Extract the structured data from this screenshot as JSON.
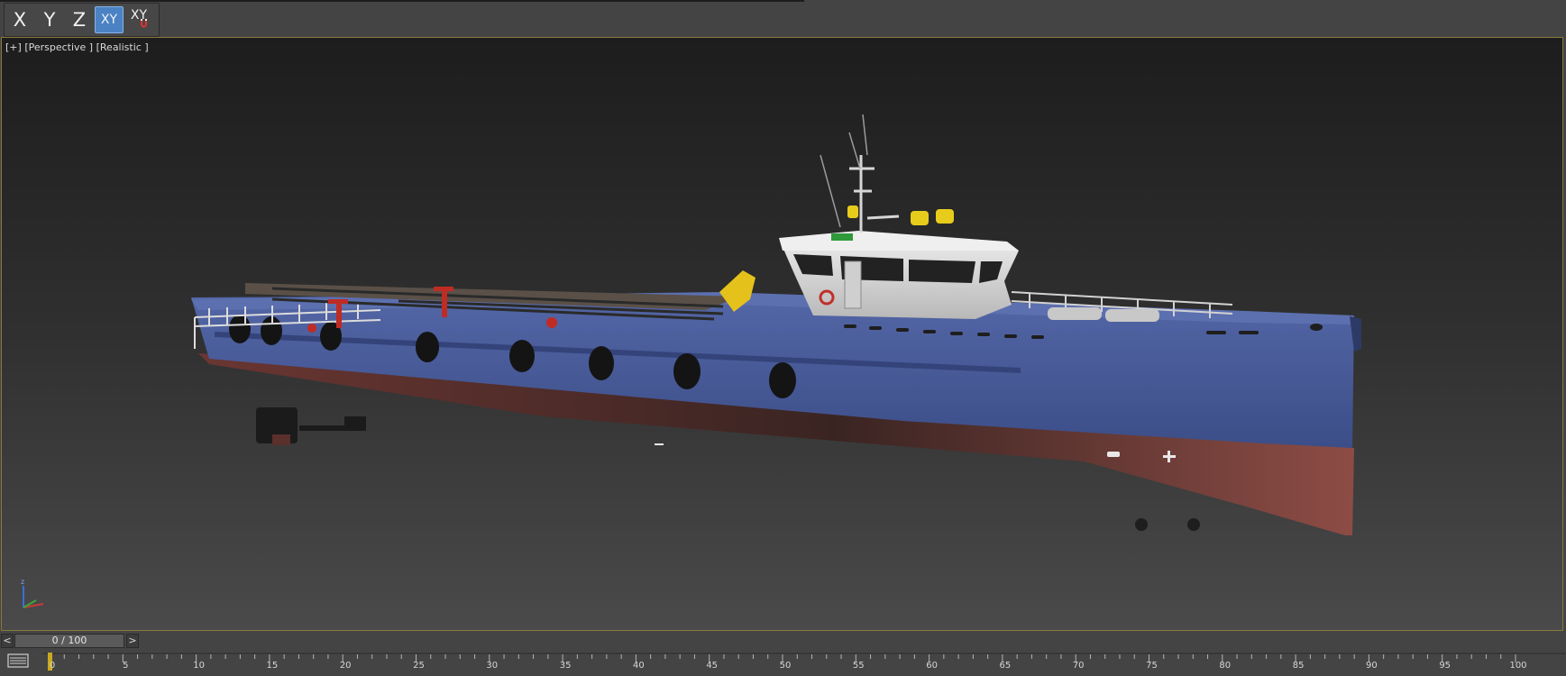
{
  "toolbar": {
    "axis_buttons": [
      {
        "label": "X",
        "active": false
      },
      {
        "label": "Y",
        "active": false
      },
      {
        "label": "Z",
        "active": false
      },
      {
        "label": "XY",
        "active": true
      },
      {
        "label": "XY",
        "active": false,
        "icon": "magnet-snap-icon"
      }
    ]
  },
  "viewport": {
    "label_plus": "[+]",
    "label_view": "[Perspective ]",
    "label_shading": "[Realistic ]",
    "gizmo_axis": "z"
  },
  "time_slider": {
    "prev": "<",
    "next": ">",
    "value": "0 / 100"
  },
  "track_bar": {
    "ticks": [
      "0",
      "5",
      "10",
      "15",
      "20",
      "25",
      "30",
      "35",
      "40",
      "45",
      "50",
      "55",
      "60",
      "65",
      "70",
      "75",
      "80",
      "85",
      "90",
      "95",
      "100"
    ]
  },
  "colors": {
    "hull_blue": "#4a5c9a",
    "hull_bottom": "#8a4a44",
    "superstructure": "#d8d8d8",
    "frame_border": "#8a7a3b",
    "active_button": "#4b82c4"
  }
}
